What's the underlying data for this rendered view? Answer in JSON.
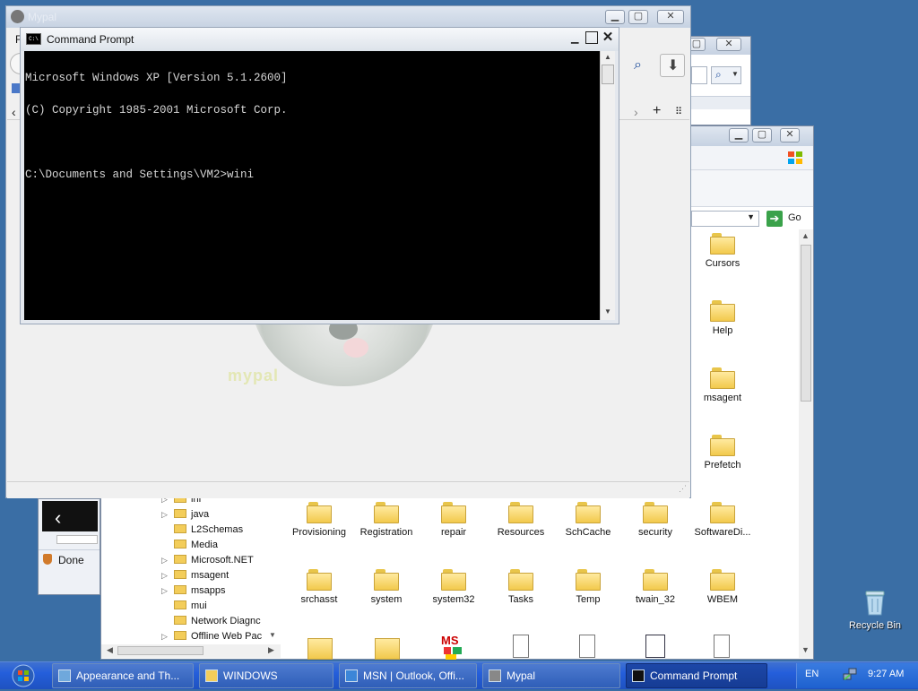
{
  "mypal_window": {
    "title": "Mypal",
    "menu_letter": "F",
    "status_text": "Done",
    "logo_text": "mypal"
  },
  "ie_window": {},
  "explorer_window": {
    "go_label": "Go",
    "right_column_folders": [
      "Cursors",
      "Help",
      "msagent",
      "Prefetch"
    ],
    "grid_row1": [
      "Provisioning",
      "Registration",
      "repair",
      "Resources",
      "SchCache",
      "security",
      "SoftwareDi..."
    ],
    "grid_row2": [
      "srchasst",
      "system",
      "system32",
      "Tasks",
      "Temp",
      "twain_32",
      "WBEM"
    ],
    "tree_items": [
      "inf",
      "java",
      "L2Schemas",
      "Media",
      "Microsoft.NET",
      "msagent",
      "msapps",
      "mui",
      "Network Diagnc",
      "Offline Web Pac"
    ],
    "tree_has_arrow": [
      true,
      true,
      false,
      false,
      true,
      true,
      true,
      false,
      false,
      true
    ]
  },
  "cmd_window": {
    "title": "Command Prompt",
    "icon_text": "C:\\",
    "lines": [
      "Microsoft Windows XP [Version 5.1.2600]",
      "(C) Copyright 1985-2001 Microsoft Corp.",
      "",
      "C:\\Documents and Settings\\VM2>wini"
    ]
  },
  "desktop": {
    "recycle_bin_label": "Recycle Bin"
  },
  "taskbar": {
    "items": [
      {
        "label": "Appearance and Th...",
        "icon": "control-panel-icon"
      },
      {
        "label": "WINDOWS",
        "icon": "folder-icon"
      },
      {
        "label": "MSN | Outlook, Offi...",
        "icon": "ie-icon"
      },
      {
        "label": "Mypal",
        "icon": "mypal-icon"
      },
      {
        "label": "Command Prompt",
        "icon": "cmd-icon",
        "active": true
      }
    ],
    "language": "EN",
    "clock": "9:27 AM"
  },
  "colors": {
    "desktop": "#3a6ea5",
    "taskbar": "#245edb",
    "cmd_bg": "#000000",
    "cmd_text": "#d6d6d6"
  }
}
